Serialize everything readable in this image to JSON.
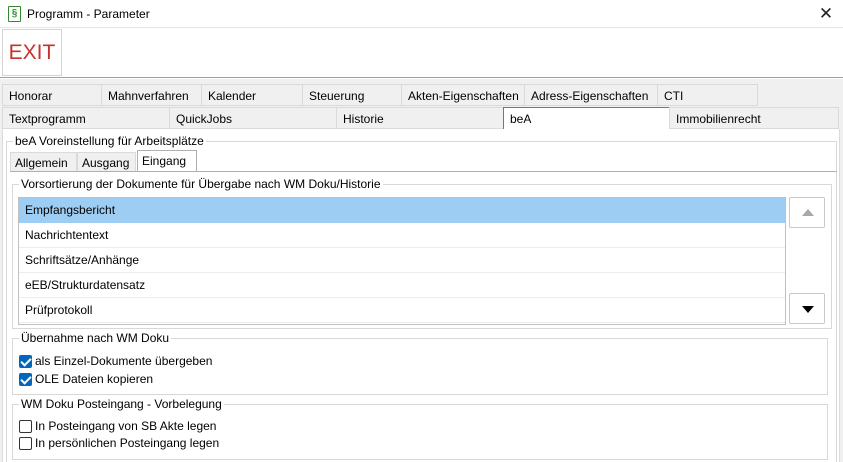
{
  "window": {
    "title": "Programm - Parameter",
    "app_icon_glyph": "§",
    "close_glyph": "✕"
  },
  "toolbar": {
    "exit_label": "EXIT"
  },
  "tabs_row1": [
    "Honorar",
    "Mahnverfahren",
    "Kalender",
    "Steuerung",
    "Akten-Eigenschaften",
    "Adress-Eigenschaften",
    "CTI"
  ],
  "tabs_row2": [
    "Textprogramm",
    "QuickJobs",
    "Historie",
    "beA",
    "Immobilienrecht"
  ],
  "section": {
    "title": "beA Voreinstellung für Arbeitsplätze",
    "subtabs": [
      "Allgemein",
      "Ausgang",
      "Eingang"
    ],
    "sort_group": {
      "title": "Vorsortierung der Dokumente für Übergabe nach WM Doku/Historie",
      "items": [
        "Empfangsbericht",
        "Nachrichtentext",
        "Schriftsätze/Anhänge",
        "eEB/Strukturdatensatz",
        "Prüfprotokoll"
      ]
    },
    "transfer_group": {
      "title": "Übernahme nach WM Doku",
      "options": [
        {
          "label": "als Einzel-Dokumente übergeben",
          "checked": true
        },
        {
          "label": "OLE Dateien kopieren",
          "checked": true
        }
      ]
    },
    "inbox_group": {
      "title": "WM Doku Posteingang - Vorbelegung",
      "options": [
        {
          "label": "In Posteingang von SB Akte legen",
          "checked": false
        },
        {
          "label": "In persönlichen Posteingang legen",
          "checked": false
        }
      ]
    }
  },
  "icons": {
    "app": "paragraph-icon",
    "close": "close-icon",
    "up": "triangle-up-icon",
    "down": "triangle-down-icon"
  },
  "colors": {
    "exit": "#c8322d",
    "selection": "#9dcdf3",
    "checkbox": "#0067c0"
  }
}
